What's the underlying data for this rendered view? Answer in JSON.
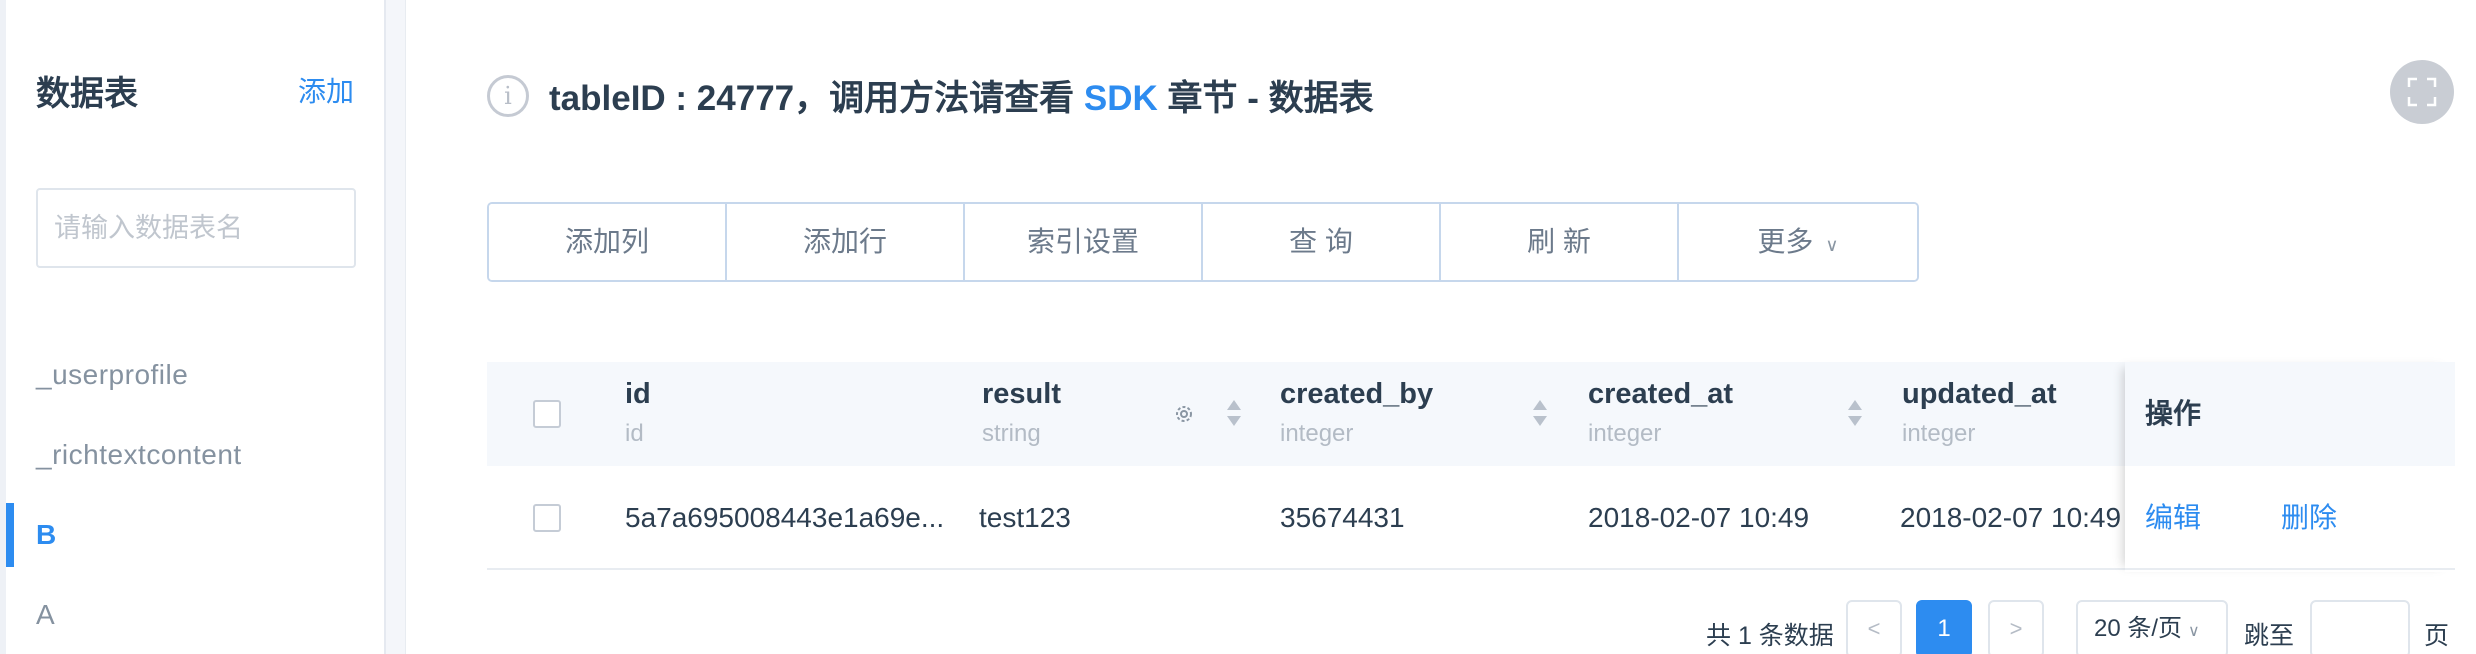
{
  "sidebar": {
    "title": "数据表",
    "add_label": "添加",
    "search_placeholder": "请输入数据表名",
    "items": [
      {
        "label": "_userprofile"
      },
      {
        "label": "_richtextcontent"
      },
      {
        "label": "B",
        "active": true
      },
      {
        "label": "A"
      }
    ]
  },
  "header": {
    "prefix": "tableID : 24777，调用方法请查看 ",
    "link": "SDK",
    "suffix": " 章节 - 数据表",
    "info_icon": "info-circle-icon"
  },
  "fullscreen_icon": "fullscreen-icon",
  "toolbar": {
    "add_column": "添加列",
    "add_row": "添加行",
    "index_settings": "索引设置",
    "query": "查 询",
    "refresh": "刷 新",
    "more": "更多"
  },
  "table": {
    "columns": [
      {
        "name": "id",
        "type": "id"
      },
      {
        "name": "result",
        "type": "string"
      },
      {
        "name": "created_by",
        "type": "integer"
      },
      {
        "name": "created_at",
        "type": "integer"
      },
      {
        "name": "updated_at",
        "type": "integer"
      }
    ],
    "action_header": "操作",
    "rows": [
      {
        "id": "5a7a695008443e1a69e...",
        "result": "test123",
        "created_by": "35674431",
        "created_at": "2018-02-07 10:49",
        "updated_at": "2018-02-07 10:49",
        "edit": "编辑",
        "delete": "删除"
      }
    ]
  },
  "pagination": {
    "total": "共 1 条数据",
    "prev": "<",
    "current": "1",
    "next": ">",
    "page_size": "20 条/页",
    "jump_label": "跳至",
    "page_label": "页"
  },
  "colors": {
    "accent": "#2d8cf0",
    "header_bg": "#f5f8fc",
    "text": "#2c3e50"
  }
}
